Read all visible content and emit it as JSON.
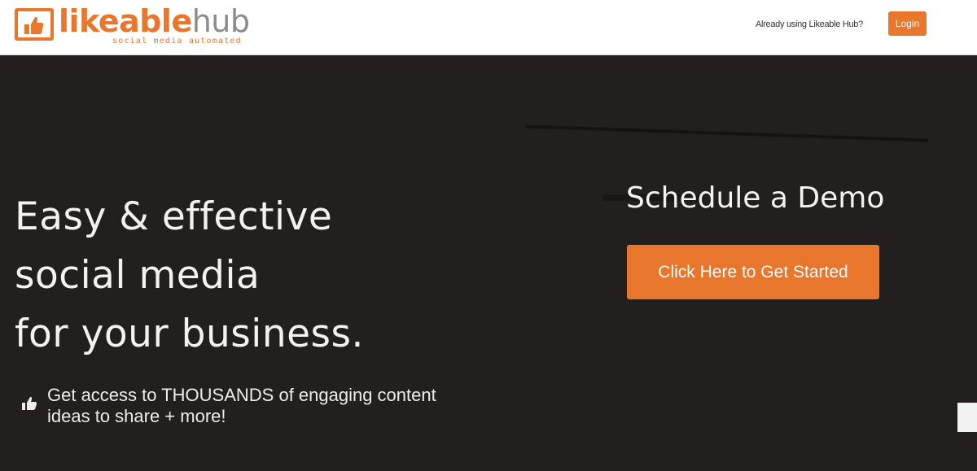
{
  "header": {
    "logo": {
      "word_primary": "likeable",
      "word_secondary": "hub",
      "tagline": "social media automated",
      "icon": "thumbs-up-icon"
    },
    "already_text": "Already using Likeable Hub?",
    "login_label": "Login"
  },
  "hero": {
    "headline_lines": [
      "Easy & effective",
      "social media",
      "for your business."
    ],
    "feature": {
      "icon": "thumbs-up-icon",
      "text": "Get access to THOUSANDS of engaging content ideas to share + more!"
    },
    "demo": {
      "title": "Schedule a Demo",
      "cta_label": "Click Here to Get Started"
    }
  },
  "colors": {
    "accent": "#e8762d",
    "hero_background": "#221f1e",
    "header_background": "#ffffff",
    "text_light": "#f4f1ee"
  }
}
